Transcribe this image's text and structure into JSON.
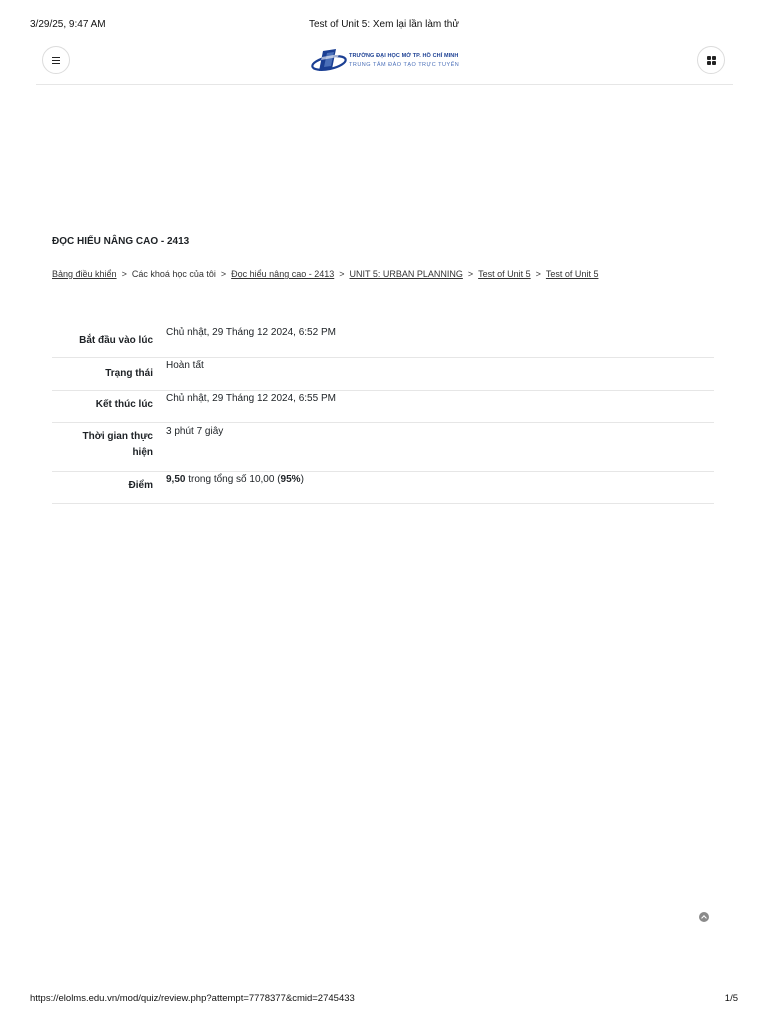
{
  "print_header": {
    "datetime": "3/29/25, 9:47 AM",
    "page_title": "Test of Unit 5: Xem lại lần làm thử"
  },
  "navbar": {
    "menu_icon": "hamburger-icon",
    "apps_icon": "grid-icon",
    "logo": {
      "line1": "TRƯỜNG ĐẠI HỌC MỞ TP. HỒ CHÍ MINH",
      "line2": "TRUNG TÂM ĐÀO TẠO TRỰC TUYẾN",
      "colors": {
        "primary": "#1b3f93",
        "secondary": "#4a6fb8"
      }
    }
  },
  "course": {
    "heading": "ĐỌC HIỂU NÂNG CAO - 2413"
  },
  "breadcrumb": {
    "separator": ">",
    "items": [
      {
        "label": "Bảng điều khiển",
        "link": true
      },
      {
        "label": "Các khoá học của tôi",
        "link": false
      },
      {
        "label": "Đọc hiểu nâng cao - 2413",
        "link": true
      },
      {
        "label": "UNIT 5: URBAN PLANNING",
        "link": true
      },
      {
        "label": "Test of Unit 5",
        "link": true
      },
      {
        "label": "Test of Unit 5",
        "link": true
      }
    ]
  },
  "summary": {
    "started": {
      "label": "Bắt đầu vào lúc",
      "value": "Chủ nhật, 29 Tháng 12 2024, 6:52 PM"
    },
    "state": {
      "label": "Trạng thái",
      "value": "Hoàn tất"
    },
    "completed": {
      "label": "Kết thúc lúc",
      "value": "Chủ nhật, 29 Tháng 12 2024, 6:55 PM"
    },
    "duration": {
      "label_line1": "Thời gian thực",
      "label_line2": "hiện",
      "value": "3 phút 7 giây"
    },
    "grade": {
      "label": "Điểm",
      "score": "9,50",
      "text_mid": " trong tổng số 10,00 (",
      "percent": "95%",
      "text_end": ")"
    }
  },
  "back_to_top_icon": "arrow-up-circle-icon",
  "print_footer": {
    "url": "https://elolms.edu.vn/mod/quiz/review.php?attempt=7778377&cmid=2745433",
    "page": "1/5"
  }
}
